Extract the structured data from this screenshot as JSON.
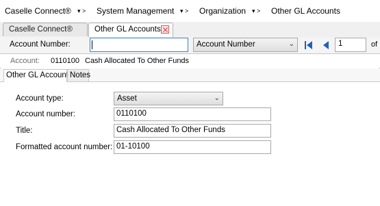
{
  "breadcrumb": {
    "items": [
      "Caselle Connect®",
      "System Management",
      "Organization",
      "Other GL Accounts"
    ],
    "separators": [
      "▾ >",
      "▾ >",
      "▾ >"
    ]
  },
  "tabs": [
    {
      "label": "Caselle Connect®",
      "active": false
    },
    {
      "label": "Other GL Accounts",
      "active": true,
      "closable": true
    }
  ],
  "search": {
    "label": "Account Number:",
    "value": "",
    "field_select": "Account Number",
    "page_value": "1",
    "of_label": "of"
  },
  "account": {
    "label": "Account:",
    "number": "0110100",
    "title": "Cash Allocated To Other Funds"
  },
  "subtabs": [
    {
      "label": "Other GL Account",
      "active": true
    },
    {
      "label": "Notes",
      "active": false
    }
  ],
  "form": {
    "account_type_label": "Account type:",
    "account_type_value": "Asset",
    "account_number_label": "Account number:",
    "account_number_value": "0110100",
    "title_label": "Title:",
    "title_value": "Cash Allocated To Other Funds",
    "formatted_label": "Formatted account number:",
    "formatted_value": "01-10100"
  },
  "icons": {
    "first": "first-record-icon",
    "prev": "previous-record-icon",
    "close": "close-tab-icon",
    "dropdown": "chevron-down-icon"
  },
  "colors": {
    "accent_blue": "#1f5fbf",
    "close_red": "#c0392b",
    "focus_border": "#3b7fc4"
  }
}
